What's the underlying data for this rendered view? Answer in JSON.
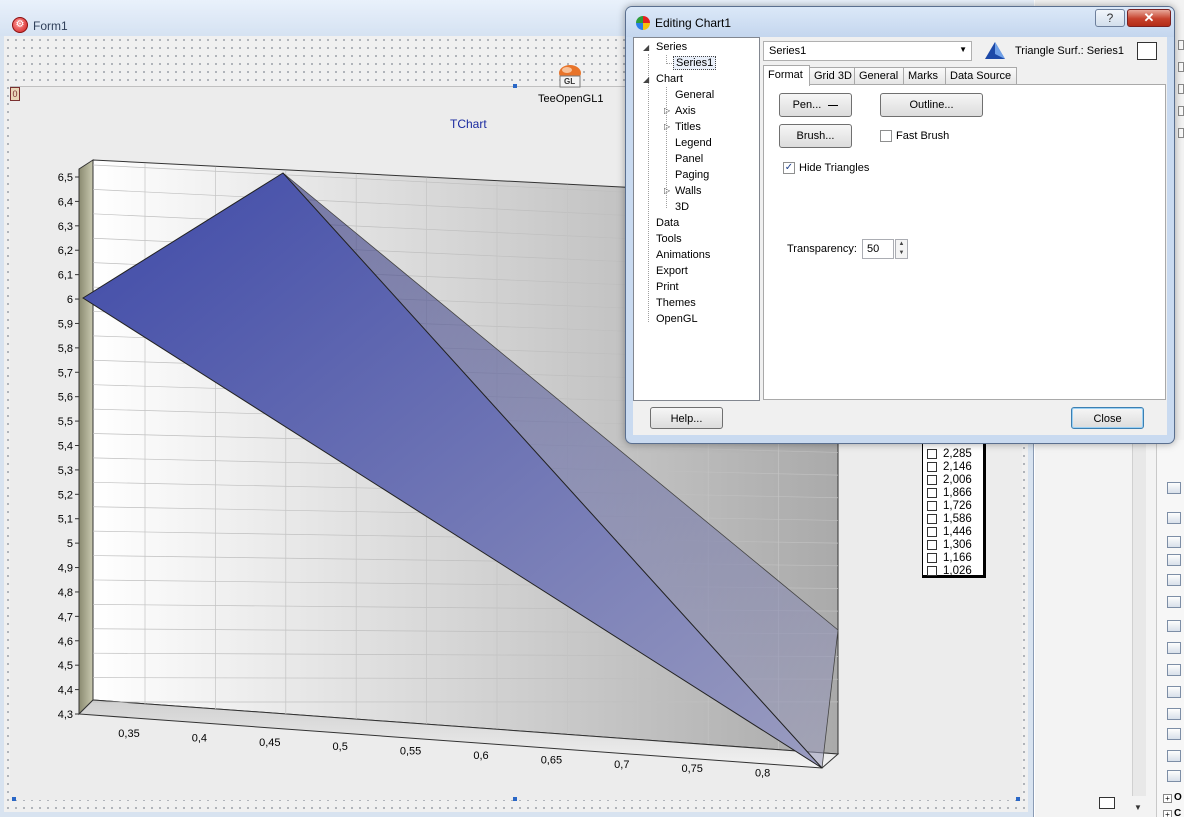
{
  "form": {
    "title": "Form1",
    "panel_marker": "0",
    "gl_component_label": "TeeOpenGL1",
    "gl_icon_text": "GL"
  },
  "chart_data": {
    "type": "triangle-surface-3d",
    "title": "TChart",
    "series_name": "Series1",
    "x_ticks": [
      "0,35",
      "0,4",
      "0,45",
      "0,5",
      "0,55",
      "0,6",
      "0,65",
      "0,7",
      "0,75",
      "0,8"
    ],
    "y_ticks": [
      "6,5",
      "6,4",
      "6,3",
      "6,2",
      "6,1",
      "6",
      "5,9",
      "5,8",
      "5,7",
      "5,6",
      "5,5",
      "5,4",
      "5,3",
      "5,2",
      "5,1",
      "5",
      "4,9",
      "4,8",
      "4,7",
      "4,6",
      "4,5",
      "4,4",
      "4,3"
    ],
    "ylim": [
      4.3,
      6.5
    ],
    "legend_values": [
      "2,285",
      "2,146",
      "2,006",
      "1,866",
      "1,726",
      "1,586",
      "1,446",
      "1,306",
      "1,166",
      "1,026"
    ],
    "surface_color": "#1e247a",
    "back_wall_color": "#b4b4b4",
    "grid": true
  },
  "dialog": {
    "title": "Editing Chart1",
    "help_glyph": "?",
    "close_glyph": "✕",
    "tree": {
      "series": "Series",
      "series1": "Series1",
      "chart": "Chart",
      "general": "General",
      "axis": "Axis",
      "titles": "Titles",
      "legend": "Legend",
      "panel": "Panel",
      "paging": "Paging",
      "walls": "Walls",
      "three_d": "3D",
      "data": "Data",
      "tools": "Tools",
      "animations": "Animations",
      "export": "Export",
      "print": "Print",
      "themes": "Themes",
      "opengl": "OpenGL"
    },
    "series_combo": "Series1",
    "series_type": "Triangle Surf.: Series1",
    "tabs": {
      "format": "Format",
      "grid3d": "Grid 3D",
      "general": "General",
      "marks": "Marks",
      "data_source": "Data Source"
    },
    "format": {
      "pen_button": "Pen...",
      "outline_button": "Outline...",
      "brush_button": "Brush...",
      "fast_brush": "Fast Brush",
      "fast_brush_checked": false,
      "hide_triangles": "Hide Triangles",
      "hide_triangles_checked": true,
      "transparency_label": "Transparency:",
      "transparency_value": "50",
      "check_glyph": "✓"
    },
    "help_button": "Help...",
    "close_button": "Close"
  },
  "ide": {
    "palette_group_1": "O",
    "palette_group_2": "C"
  }
}
